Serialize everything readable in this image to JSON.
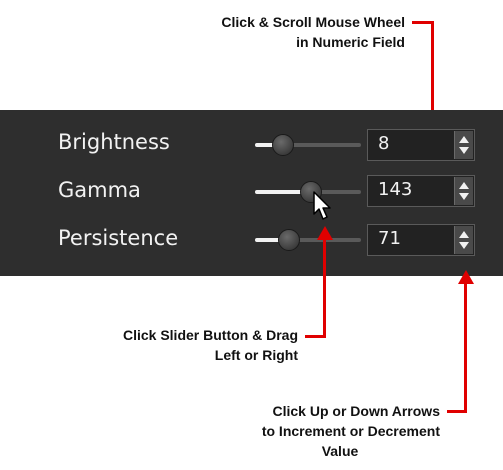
{
  "callouts": {
    "scroll_line1": "Click & Scroll Mouse Wheel",
    "scroll_line2": "in Numeric Field",
    "slider_line1": "Click Slider Button & Drag",
    "slider_line2": "Left or Right",
    "arrows_line1": "Click Up or Down Arrows",
    "arrows_line2": "to Increment or Decrement",
    "arrows_line3": "Value"
  },
  "controls": [
    {
      "label": "Brightness",
      "value": "8",
      "slider_level": 0.2
    },
    {
      "label": "Gamma",
      "value": "143",
      "slider_level": 0.5
    },
    {
      "label": "Persistence",
      "value": "71",
      "slider_level": 0.28
    }
  ],
  "colors": {
    "panel_bg": "#2e2e2e",
    "leader_red": "#e00000",
    "text_light": "#f2f2f2"
  },
  "icons": {
    "cursor": "mouse-pointer-icon",
    "spin": "up-down-arrows-icon"
  }
}
